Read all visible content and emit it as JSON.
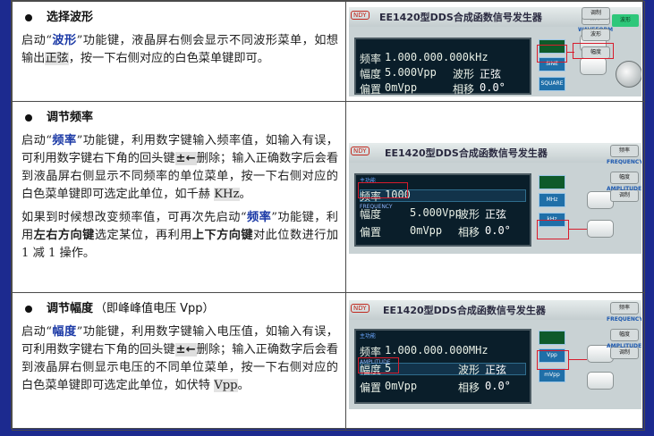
{
  "sections": [
    {
      "heading": "选择波形",
      "body": [
        {
          "t": "启动“"
        },
        {
          "t": "波形",
          "kw": true
        },
        {
          "t": "”功能键，液晶屏右侧会显示不同波形菜单，如想输出"
        },
        {
          "t": "正弦",
          "hl": true
        },
        {
          "t": "，按一下右侧对应的白色菜单键即可。"
        }
      ],
      "panel": {
        "ndy": "NDY",
        "title": "EE1420型DDS合成函数信号发生器",
        "lines": [
          {
            "label": "频率",
            "value": "1.000.000.000kHz"
          },
          {
            "label": "幅度",
            "value": "5.000Vpp",
            "extra_label": "波形",
            "extra_value": "正弦"
          },
          {
            "label": "偏置",
            "value": "0mVpp",
            "extra_label": "相移",
            "extra_value": "0.0°"
          }
        ],
        "menu": [
          "SINE",
          "SQUARE"
        ],
        "right_keys": [
          "频率",
          "波形",
          "幅度",
          "调制"
        ],
        "led_label": "WAVEFORM"
      }
    },
    {
      "heading": "调节频率",
      "body1": [
        {
          "t": "启动“"
        },
        {
          "t": "频率",
          "kw": true
        },
        {
          "t": "”功能键，利用数字键输入频率值，如输入有误，可利用数字键右下角的回头键"
        },
        {
          "t": "±←",
          "key": true
        },
        {
          "t": "删除；输入正确数字后会看到液晶屏右侧显示不同频率的单位菜单，按一下右侧对应的白色菜单键即可选定此单位，如千赫 "
        },
        {
          "t": "KHz",
          "hl": true
        },
        {
          "t": "。"
        }
      ],
      "body2": [
        {
          "t": "如果到时候想改变频率值，可再次先启动“"
        },
        {
          "t": "频率",
          "kw": true
        },
        {
          "t": "”功能键，利用"
        },
        {
          "t": "左右方向键",
          "b": true
        },
        {
          "t": "选定某位，再利用"
        },
        {
          "t": "上下方向键",
          "b": true
        },
        {
          "t": "对此位数进行加 1 减 1 操作。"
        }
      ],
      "panel": {
        "ndy": "NDY",
        "title": "EE1420型DDS合成函数信号发生器",
        "tag1": "主功能",
        "tag2": "FREQUENCY",
        "lines": [
          {
            "label": "频率",
            "value": "1000"
          },
          {
            "label": "幅度",
            "value": "5.000Vpp",
            "extra_label": "波形",
            "extra_value": "正弦"
          },
          {
            "label": "偏置",
            "value": "0mVpp",
            "extra_label": "相移",
            "extra_value": "0.0°"
          }
        ],
        "menu": [
          "MHz",
          "kHz"
        ],
        "right_keys": [
          "频率",
          "幅度",
          "调制"
        ],
        "led_label": "FREQUENCY",
        "led_label2": "AMPLITUDE"
      }
    },
    {
      "heading": "调节幅度",
      "heading_sub": "（即峰峰值电压 Vpp）",
      "body": [
        {
          "t": "启动“"
        },
        {
          "t": "幅度",
          "kw": true
        },
        {
          "t": "”功能键，利用数字键输入电压值，如输入有误，可利用数字键右下角的回头键"
        },
        {
          "t": "±←",
          "key": true
        },
        {
          "t": "删除；输入正确数字后会看到液晶屏右侧显示电压的不同单位菜单，按一下右侧对应的白色菜单键即可选定此单位，如伏特 "
        },
        {
          "t": "Vpp",
          "hl": true
        },
        {
          "t": "。"
        }
      ],
      "panel": {
        "ndy": "NDY",
        "title": "EE1420型DDS合成函数信号发生器",
        "tag1": "主功能",
        "tag2": "AMPLITUDE",
        "lines": [
          {
            "label": "频率",
            "value": "1.000.000.000MHz"
          },
          {
            "label": "幅度",
            "value": "5",
            "extra_label": "波形",
            "extra_value": "正弦"
          },
          {
            "label": "偏置",
            "value": "0mVpp",
            "extra_label": "相移",
            "extra_value": "0.0°"
          }
        ],
        "menu": [
          "Vpp",
          "mVpp"
        ],
        "right_keys": [
          "频率",
          "幅度",
          "调制"
        ],
        "led_label": "FREQUENCY",
        "led_label2": "AMPLITUDE"
      }
    }
  ]
}
